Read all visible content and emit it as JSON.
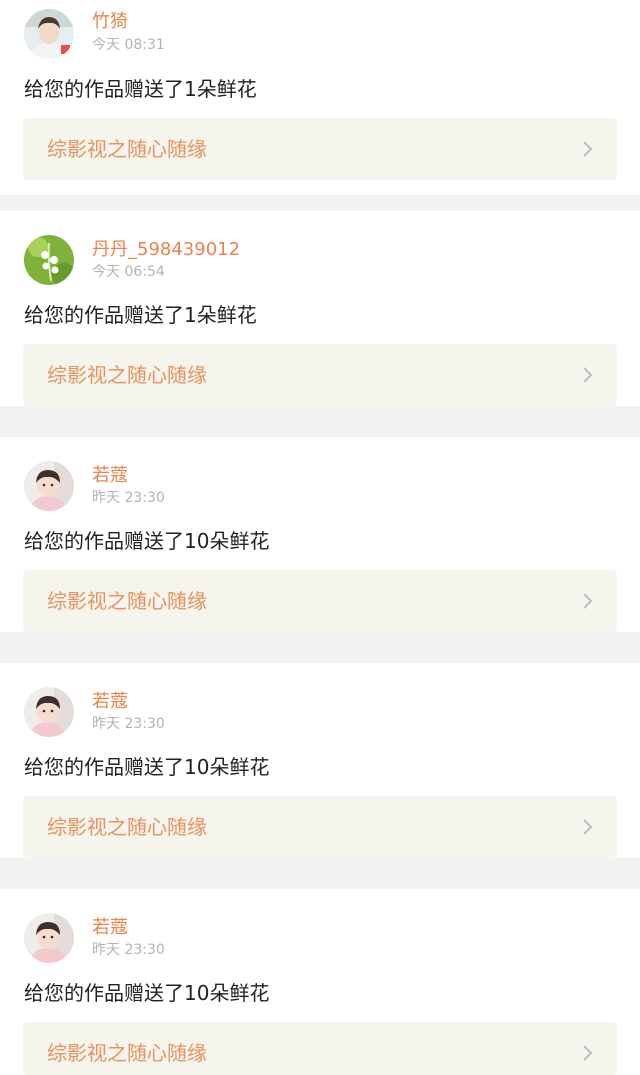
{
  "notifications": [
    {
      "username": "竹猗",
      "timestamp": "今天 08:31",
      "message": "给您的作品赠送了1朵鲜花",
      "work_title": "综影视之随心随缘",
      "avatar_icon": "portrait-boy-avatar"
    },
    {
      "username": "丹丹_598439012",
      "timestamp": "今天 06:54",
      "message": "给您的作品赠送了1朵鲜花",
      "work_title": "综影视之随心随缘",
      "avatar_icon": "lily-of-the-valley-avatar"
    },
    {
      "username": "若蔻",
      "timestamp": "昨天 23:30",
      "message": "给您的作品赠送了10朵鲜花",
      "work_title": "综影视之随心随缘",
      "avatar_icon": "child-portrait-avatar"
    },
    {
      "username": "若蔻",
      "timestamp": "昨天 23:30",
      "message": "给您的作品赠送了10朵鲜花",
      "work_title": "综影视之随心随缘",
      "avatar_icon": "child-portrait-avatar"
    },
    {
      "username": "若蔻",
      "timestamp": "昨天 23:30",
      "message": "给您的作品赠送了10朵鲜花",
      "work_title": "综影视之随心随缘",
      "avatar_icon": "child-portrait-avatar"
    }
  ],
  "colors": {
    "username": "#e8844e",
    "work_title": "#e8935f",
    "link_background": "#f5f4ed",
    "separator": "#f2f2f2"
  }
}
